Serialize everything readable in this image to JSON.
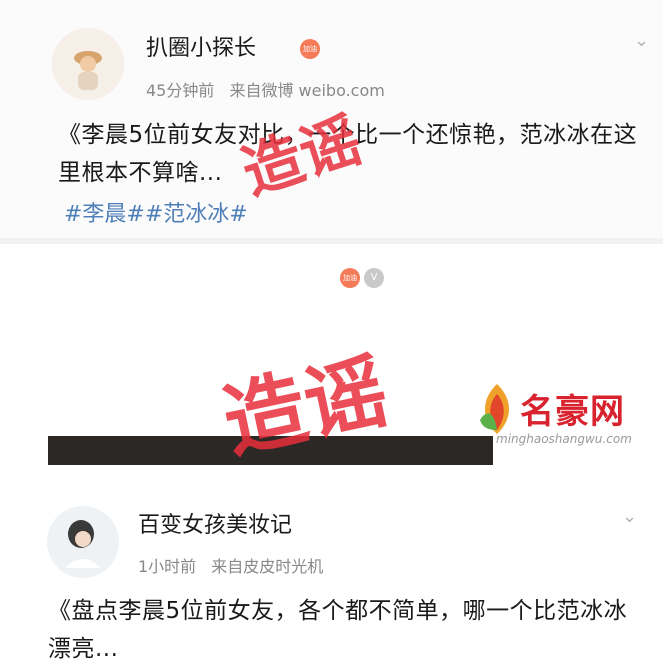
{
  "post1": {
    "username": "扒圈小探长",
    "badge": "加油",
    "time": "45分钟前",
    "source": "来自微博 weibo.com",
    "text": "《李晨5位前女友对比，一个比一个还惊艳，范冰冰在这里根本不算啥...",
    "tags": "#李晨##范冰冰#"
  },
  "post2": {
    "username": "百变女孩美妆记",
    "badge": "加油",
    "badge2": "V",
    "time": "1小时前",
    "source": "来自皮皮时光机",
    "text": "《盘点李晨5位前女友，各个都不简单，哪一个比范冰冰漂亮..."
  },
  "stamps": {
    "s1": "造谣",
    "s2": "造谣"
  },
  "watermark": {
    "name": "名豪网",
    "url": "minghaoshangwu.com"
  },
  "colors": {
    "stamp": "#e8303c",
    "tag": "#4f7fb8",
    "meta": "#888888"
  },
  "icons": {
    "chevron": "chevron-down-icon"
  }
}
